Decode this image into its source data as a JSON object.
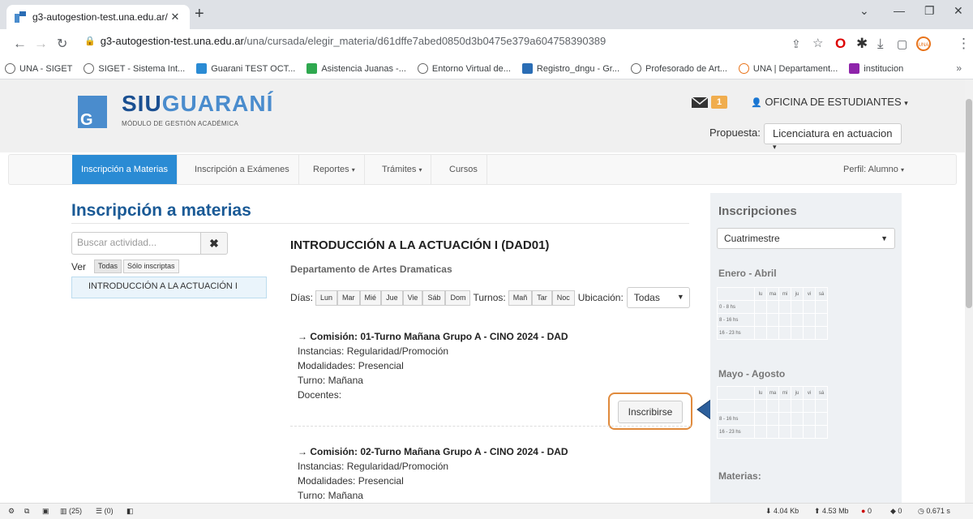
{
  "browser": {
    "tab_title": "g3-autogestion-test.una.edu.ar/",
    "url_host": "g3-autogestion-test.una.edu.ar",
    "url_path": "/una/cursada/elegir_materia/d61dffe7abed0850d3b0475e379a604758390389",
    "bookmarks": [
      "UNA - SIGET",
      "SIGET - Sistema Int...",
      "Guarani TEST OCT...",
      "Asistencia Juanas -...",
      "Entorno Virtual de...",
      "Registro_dngu - Gr...",
      "Profesorado de Art...",
      "UNA | Departament...",
      "institucion"
    ],
    "more": "»"
  },
  "header": {
    "logo_siu": "SIU",
    "logo_guarani": "GUARANÍ",
    "logo_sub": "MÓDULO DE GESTIÓN ACADÉMICA",
    "msg_count": "1",
    "user": "OFICINA DE ESTUDIANTES",
    "propuesta_label": "Propuesta:",
    "propuesta_value": "Licenciatura en actuacion"
  },
  "nav": {
    "items": [
      "Inscripción a Materias",
      "Inscripción a Exámenes",
      "Reportes",
      "Trámites",
      "Cursos"
    ],
    "perfil": "Perfil: Alumno"
  },
  "main": {
    "title": "Inscripción a materias",
    "search_placeholder": "Buscar actividad...",
    "ver_label": "Ver",
    "filter_all": "Todas",
    "filter_enrolled": "Sólo inscriptas",
    "course_item": "INTRODUCCIÓN A LA ACTUACIÓN I",
    "course_title": "INTRODUCCIÓN A LA ACTUACIÓN I (DAD01)",
    "department": "Departamento de Artes Dramaticas",
    "dias_label": "Días:",
    "days": [
      "Lun",
      "Mar",
      "Mié",
      "Jue",
      "Vie",
      "Sáb",
      "Dom"
    ],
    "turnos_label": "Turnos:",
    "turnos": [
      "Mañ",
      "Tar",
      "Noc"
    ],
    "ubicacion_label": "Ubicación:",
    "ubicacion_value": "Todas",
    "commissions": [
      {
        "title": "→ Comisión: 01-Turno Mañana Grupo A - CINO 2024 - DAD",
        "instancias": "Instancias: Regularidad/Promoción",
        "modalidades": "Modalidades: Presencial",
        "turno": "Turno: Mañana",
        "docentes": "Docentes:"
      },
      {
        "title": "→ Comisión: 02-Turno Mañana Grupo A - CINO 2024 - DAD",
        "instancias": "Instancias: Regularidad/Promoción",
        "modalidades": "Modalidades: Presencial",
        "turno": "Turno: Mañana"
      }
    ],
    "inscribirse": "Inscribirse"
  },
  "sidebar": {
    "title": "Inscripciones",
    "select_value": "Cuatrimestre",
    "period1": "Enero - Abril",
    "period2": "Mayo - Agosto",
    "days": [
      "lu",
      "ma",
      "mi",
      "ju",
      "vi",
      "sá"
    ],
    "rows1": [
      "0 - 8 hs",
      "8 - 16 hs",
      "16 - 23 hs"
    ],
    "rows2": [
      "8 - 16 hs",
      "16 - 23 hs"
    ],
    "materias": "Materias:"
  },
  "status": {
    "tabs": "(25)",
    "list": "(0)",
    "down": "4.04 Kb",
    "up": "4.53 Mb",
    "errors": "0",
    "other": "0",
    "time": "0.671 s"
  },
  "colors": {
    "nav_active": "#2a8bd4",
    "title_blue": "#1a5a96",
    "highlight_orange": "#e08a3c",
    "arrow_blue": "#2d5f9b"
  }
}
